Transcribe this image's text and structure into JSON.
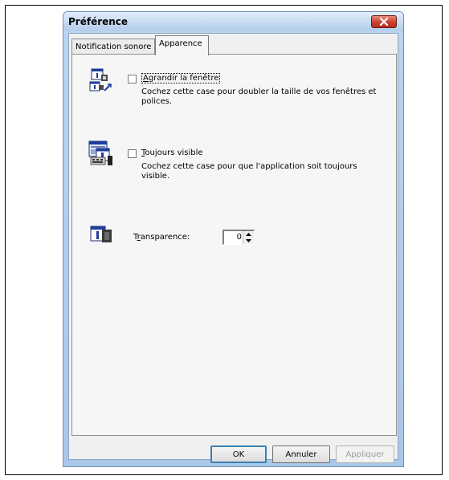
{
  "window": {
    "title": "Préférence"
  },
  "tabs": [
    {
      "label": "Notification sonore",
      "active": false
    },
    {
      "label": "Apparence",
      "active": true
    }
  ],
  "options": {
    "enlarge": {
      "checked": false,
      "label_prefix": "A",
      "label_rest": "grandir la fenêtre",
      "description": "Cochez cette case pour doubler la taille de vos fenêtres et polices."
    },
    "always_on_top": {
      "checked": false,
      "label_prefix": "T",
      "label_rest": "oujours visible",
      "description": "Cochez cette case pour que l'application soit toujours visible."
    },
    "transparency": {
      "label_prefix": "T",
      "label_mnemonic": "r",
      "label_rest": "ansparence:",
      "value": "0"
    }
  },
  "buttons": {
    "ok": "OK",
    "cancel": "Annuler",
    "apply": "Appliquer"
  },
  "icons": {
    "enlarge": "enlarge-window-icon",
    "always_on_top": "always-on-top-icon",
    "transparency": "transparency-icon",
    "close": "close-icon"
  }
}
